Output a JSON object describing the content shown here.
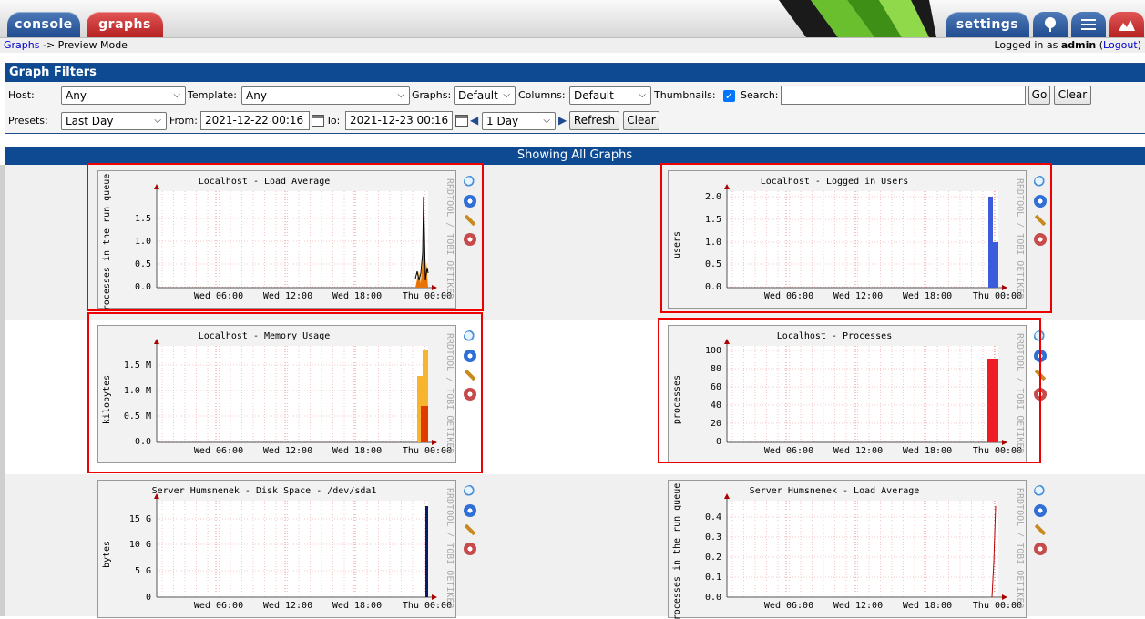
{
  "tabs": {
    "console": "console",
    "graphs": "graphs",
    "settings": "settings"
  },
  "icons": {
    "tree": "tree-icon",
    "list": "list-icon",
    "preview": "preview-icon"
  },
  "breadcrumb": {
    "link": "Graphs",
    "rest": "-> Preview Mode"
  },
  "login": {
    "prefix": "Logged in as",
    "user": "admin",
    "logout": "Logout"
  },
  "filters": {
    "title": "Graph Filters",
    "host_label": "Host:",
    "host_value": "Any",
    "template_label": "Template:",
    "template_value": "Any",
    "graphs_label": "Graphs:",
    "graphs_value": "Default",
    "columns_label": "Columns:",
    "columns_value": "Default",
    "thumbnails_label": "Thumbnails:",
    "search_label": "Search:",
    "search_value": "",
    "go": "Go",
    "clear": "Clear",
    "presets_label": "Presets:",
    "presets_value": "Last Day",
    "from_label": "From:",
    "from_value": "2021-12-22 00:16",
    "to_label": "To:",
    "to_value": "2021-12-23 00:16",
    "span_value": "1 Day",
    "refresh": "Refresh",
    "clear2": "Clear"
  },
  "showing": "Showing All Graphs",
  "watermark": "RRDTOOL / TOBI OETIKER",
  "x_ticks": [
    "Wed 06:00",
    "Wed 12:00",
    "Wed 18:00",
    "Thu 00:00"
  ],
  "graphs": [
    {
      "title": "Localhost - Load Average",
      "ylabel": "processes in the run queue",
      "yticks": [
        "0.0",
        "0.5",
        "1.0",
        "1.5"
      ]
    },
    {
      "title": "Localhost - Logged in Users",
      "ylabel": "users",
      "yticks": [
        "0.0",
        "0.5",
        "1.0",
        "1.5",
        "2.0"
      ]
    },
    {
      "title": "Localhost - Memory Usage",
      "ylabel": "kilobytes",
      "yticks": [
        "0.0",
        "0.5 M",
        "1.0 M",
        "1.5 M"
      ]
    },
    {
      "title": "Localhost - Processes",
      "ylabel": "processes",
      "yticks": [
        "0",
        "20",
        "40",
        "60",
        "80",
        "100"
      ]
    },
    {
      "title": "Server Humsnenek - Disk Space - /dev/sda1",
      "ylabel": "bytes",
      "yticks": [
        "0",
        "5 G",
        "10 G",
        "15 G"
      ]
    },
    {
      "title": "Server Humsnenek - Load Average",
      "ylabel": "processes in the run queue",
      "yticks": [
        "0.0",
        "0.1",
        "0.2",
        "0.3",
        "0.4"
      ]
    }
  ],
  "colors": {
    "header_blue": "#0d4a91",
    "tab_red": "#b52222",
    "highlight": "#e00000"
  }
}
